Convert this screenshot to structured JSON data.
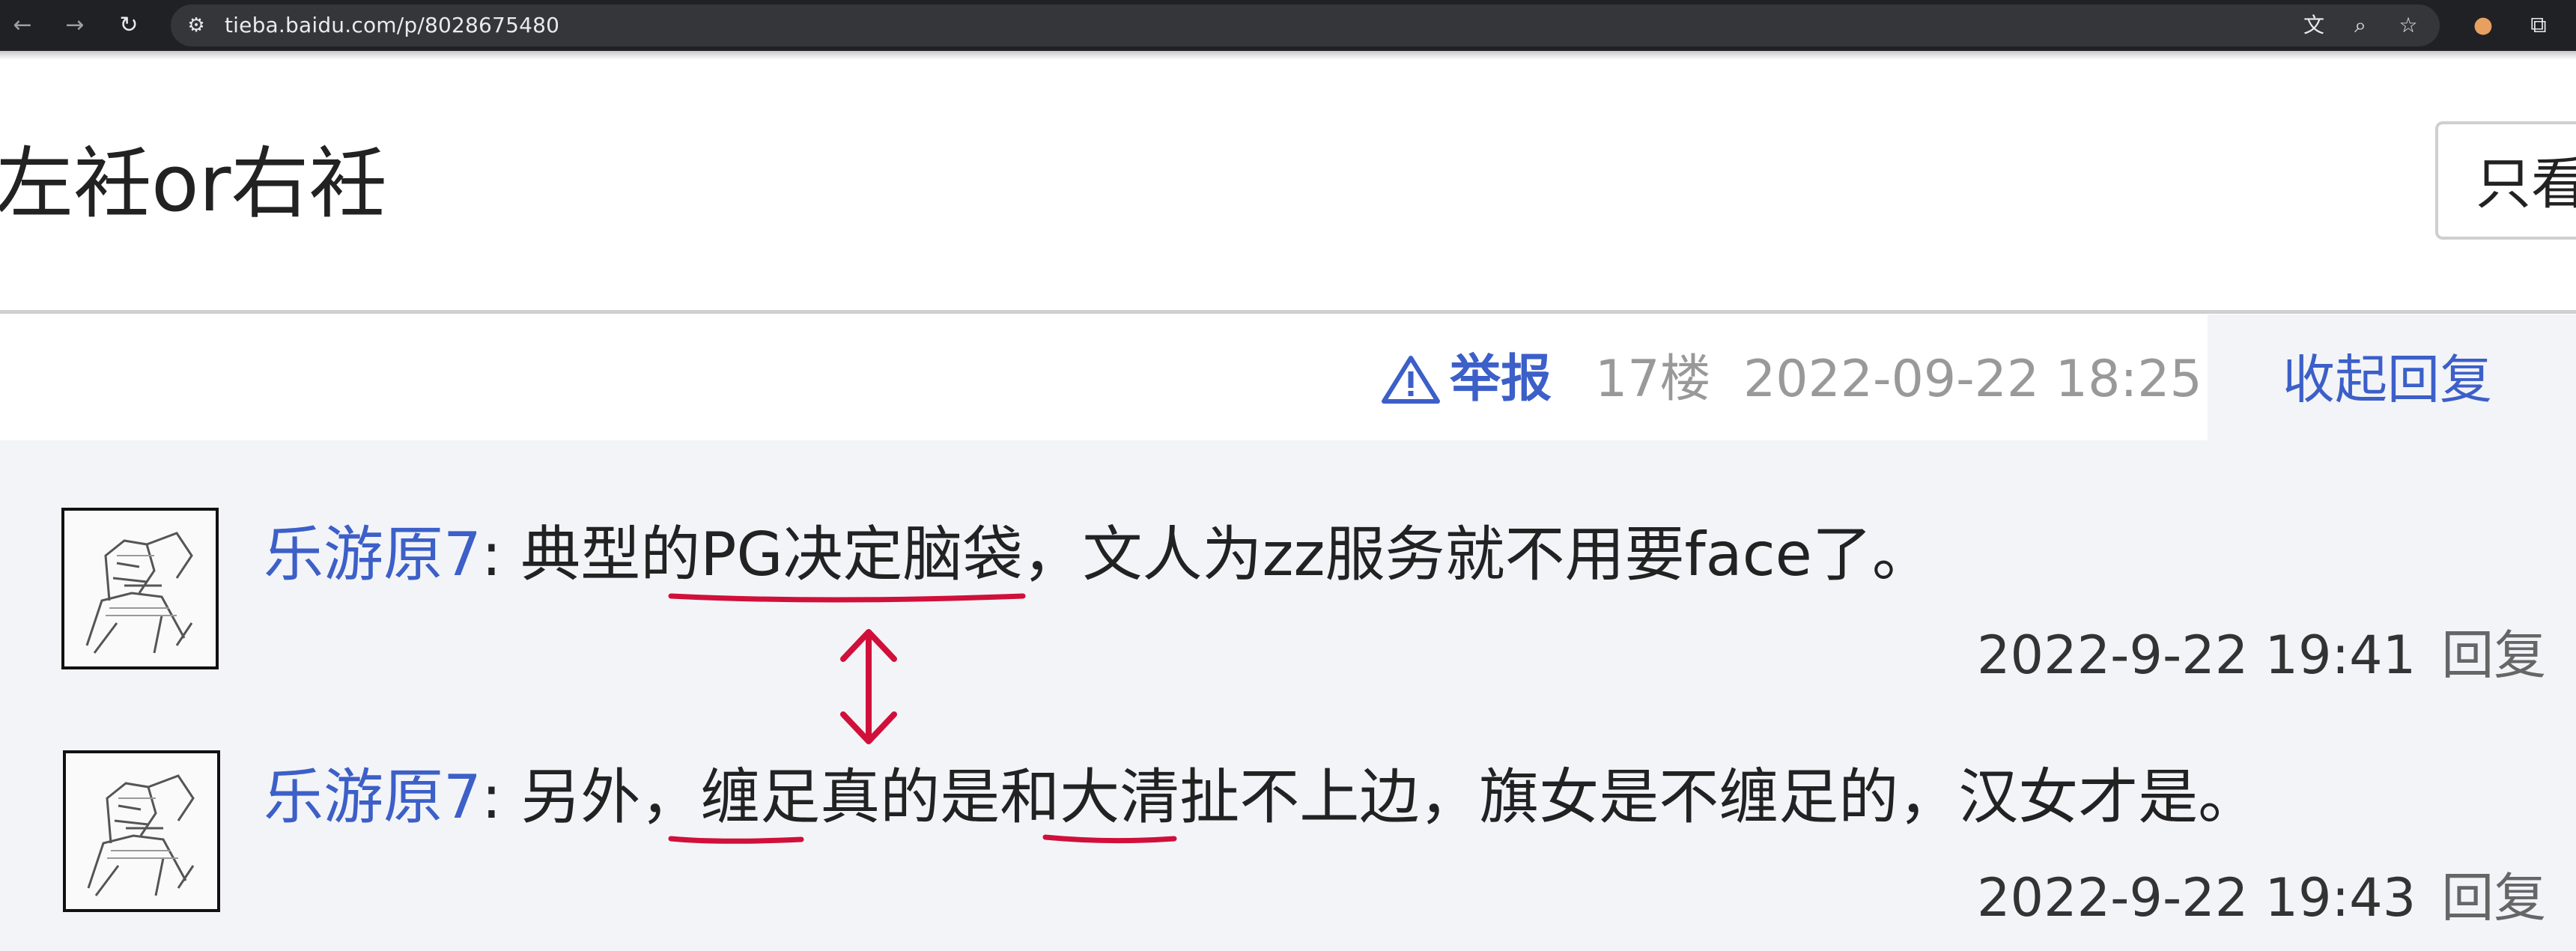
{
  "browser": {
    "url": "tieba.baidu.com/p/8028675480",
    "icons": [
      "back-arrow-icon",
      "forward-arrow-icon",
      "reload-icon",
      "site-info-icon",
      "translate-icon",
      "zoom-icon",
      "bookmark-star-icon",
      "extension-cookie-icon",
      "extensions-puzzle-icon"
    ]
  },
  "thread": {
    "title": "左衽or右衽",
    "only_lz_label": "只看"
  },
  "post": {
    "report_label": "举报",
    "floor": "17楼",
    "time": "2022-09-22 18:25",
    "collapse_label": "收起回复"
  },
  "replies": [
    {
      "user": "乐游原7",
      "separator": ": ",
      "text": "典型的PG决定脑袋，文人为zz服务就不用要face了。",
      "time": "2022-9-22 19:41",
      "reply_label": "回复"
    },
    {
      "user": "乐游原7",
      "separator": ": ",
      "text": "另外，缠足真的是和大清扯不上边，旗女是不缠足的，汉女才是。",
      "time": "2022-9-22 19:43",
      "reply_label": "回复"
    }
  ],
  "colors": {
    "link_blue": "#3c5fc8",
    "annotation_red": "#d0103a",
    "reply_bg": "#f3f4f8"
  }
}
